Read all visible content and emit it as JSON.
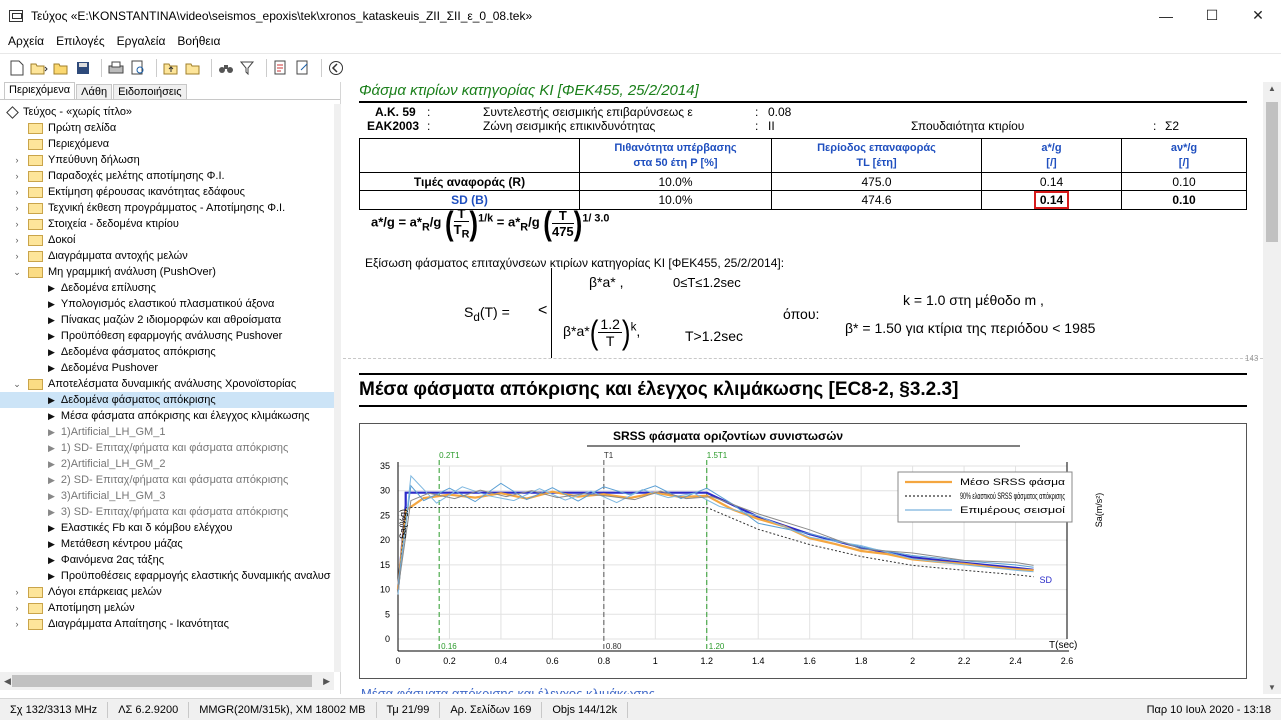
{
  "window": {
    "title": "Τεύχος «E:\\KONSTANTINA\\video\\seismos_epoxis\\tek\\xronos_kataskeuis_ZII_ΣII_ε_0_08.tek»",
    "minimize": "—",
    "maximize": "☐",
    "close": "✕"
  },
  "menu": [
    "Αρχεία",
    "Επιλογές",
    "Εργαλεία",
    "Βοήθεια"
  ],
  "tabs": [
    "Περιεχόμενα",
    "Λάθη",
    "Ειδοποιήσεις"
  ],
  "tree": [
    {
      "label": "Τεύχος - «χωρίς τίτλο»",
      "icon": "diamond",
      "level": 0,
      "exp": ""
    },
    {
      "label": "Πρώτη σελίδα",
      "icon": "folder",
      "level": 1,
      "exp": ""
    },
    {
      "label": "Περιεχόμενα",
      "icon": "folder",
      "level": 1,
      "exp": ""
    },
    {
      "label": "Υπεύθυνη δήλωση",
      "icon": "folder",
      "level": 1,
      "exp": ">"
    },
    {
      "label": "Παραδοχές μελέτης αποτίμησης Φ.Ι.",
      "icon": "folder",
      "level": 1,
      "exp": ">"
    },
    {
      "label": "Εκτίμηση φέρουσας ικανότητας εδάφους",
      "icon": "folder",
      "level": 1,
      "exp": ">"
    },
    {
      "label": "Τεχνική έκθεση προγράμματος - Αποτίμησης Φ.Ι.",
      "icon": "folder",
      "level": 1,
      "exp": ">"
    },
    {
      "label": "Στοιχεία - δεδομένα κτιρίου",
      "icon": "folder",
      "level": 1,
      "exp": ">"
    },
    {
      "label": "Δοκοί",
      "icon": "folder",
      "level": 1,
      "exp": ">"
    },
    {
      "label": "Διαγράμματα αντοχής μελών",
      "icon": "folder",
      "level": 1,
      "exp": ">"
    },
    {
      "label": "Μη γραμμική ανάλυση (PushOver)",
      "icon": "folder-open",
      "level": 1,
      "exp": "v"
    },
    {
      "label": "Δεδομένα επίλυσης",
      "icon": "arrow",
      "level": 2,
      "exp": ""
    },
    {
      "label": "Υπολογισμός ελαστικού πλασματικού άξονα",
      "icon": "arrow",
      "level": 2,
      "exp": ""
    },
    {
      "label": "Πίνακας μαζών 2 ιδιομορφών και αθροίσματα",
      "icon": "arrow",
      "level": 2,
      "exp": ""
    },
    {
      "label": "Προϋπόθεση εφαρμογής ανάλυσης Pushover",
      "icon": "arrow",
      "level": 2,
      "exp": ""
    },
    {
      "label": "Δεδομένα φάσματος απόκρισης",
      "icon": "arrow",
      "level": 2,
      "exp": ""
    },
    {
      "label": "Δεδομένα Pushover",
      "icon": "arrow",
      "level": 2,
      "exp": ""
    },
    {
      "label": "Αποτελέσματα δυναμικής ανάλυσης Χρονοϊστορίας",
      "icon": "folder-open",
      "level": 1,
      "exp": "v"
    },
    {
      "label": "Δεδομένα φάσματος απόκρισης",
      "icon": "arrow",
      "level": 2,
      "exp": "",
      "selected": true
    },
    {
      "label": "Μέσα φάσματα απόκρισης και έλεγχος κλιμάκωσης",
      "icon": "arrow",
      "level": 2,
      "exp": ""
    },
    {
      "label": "1)Artificial_LH_GM_1",
      "icon": "arrow-gray",
      "level": 2,
      "exp": ""
    },
    {
      "label": "1) SD- Επιταχ/φήματα και φάσματα απόκρισης",
      "icon": "arrow-gray",
      "level": 2,
      "exp": ""
    },
    {
      "label": "2)Artificial_LH_GM_2",
      "icon": "arrow-gray",
      "level": 2,
      "exp": ""
    },
    {
      "label": "2) SD- Επιταχ/φήματα και φάσματα απόκρισης",
      "icon": "arrow-gray",
      "level": 2,
      "exp": ""
    },
    {
      "label": "3)Artificial_LH_GM_3",
      "icon": "arrow-gray",
      "level": 2,
      "exp": ""
    },
    {
      "label": "3) SD- Επιταχ/φήματα και φάσματα απόκρισης",
      "icon": "arrow-gray",
      "level": 2,
      "exp": ""
    },
    {
      "label": "Ελαστικές Fb και δ κόμβου ελέγχου",
      "icon": "arrow",
      "level": 2,
      "exp": ""
    },
    {
      "label": "Μετάθεση κέντρου μάζας",
      "icon": "arrow",
      "level": 2,
      "exp": ""
    },
    {
      "label": "Φαινόμενα 2ας τάξης",
      "icon": "arrow",
      "level": 2,
      "exp": ""
    },
    {
      "label": "Προϋποθέσεις εφαρμογής ελαστικής δυναμικής αναλυσ",
      "icon": "arrow",
      "level": 2,
      "exp": ""
    },
    {
      "label": "Λόγοι επάρκειας μελών",
      "icon": "folder",
      "level": 1,
      "exp": ">"
    },
    {
      "label": "Αποτίμηση μελών",
      "icon": "folder",
      "level": 1,
      "exp": ">"
    },
    {
      "label": "Διαγράμματα Απαίτησης - Ικανότητας",
      "icon": "folder",
      "level": 1,
      "exp": ">"
    }
  ],
  "doc": {
    "heading1": "Φάσμα κτιρίων κατηγορίας ΚΙ [ΦΕΚ455, 25/2/2014]",
    "ak_label": "Α.Κ. 59",
    "ak_colon": ":",
    "ak_desc": "Συντελεστής σεισμικής επιβαρύνσεως ε",
    "ak_val": "0.08",
    "eak_label": "ΕΑΚ2003",
    "eak_colon": ":",
    "eak_desc": "Ζώνη σεισμικής επικινδυνότητας",
    "eak_val": "ΙΙ",
    "importance_label": "Σπουδαιότητα κτιρίου",
    "importance_colon": ":",
    "importance_val": "Σ2",
    "table": {
      "headers": [
        "",
        "Πιθανότητα υπέρβασης\nστα 50 έτη P [%]",
        "Περίοδος επαναφοράς\nTL [έτη]",
        "a*/g\n[/]",
        "aν*/g\n[/]"
      ],
      "rows": [
        [
          "Τιμές αναφοράς (R)",
          "10.0%",
          "475.0",
          "0.14",
          "0.10"
        ],
        [
          "SD (B)",
          "10.0%",
          "474.6",
          "0.14",
          "0.10"
        ]
      ]
    },
    "formula1": {
      "lhs": "a*/g  =  a*",
      "sub_r": "R",
      "mid": "/g",
      "t": "T",
      "tr": "T",
      "tr_sub": "R",
      "exp1": "1/k",
      "eq": "=  a*",
      "sub_r2": "R",
      "mid2": "/g",
      "t2": "T",
      "den2": "475",
      "exp2": "1/  3.0"
    },
    "eq_title": "Εξίσωση φάσματος επιταχύνσεων κτιρίων κατηγορίας ΚΙ [ΦΕΚ455, 25/2/2014]:",
    "sd_label": "S",
    "sd_sub": "d",
    "sd_rest": "(T)   =",
    "case1": "β*a* ,",
    "case1_cond": "0≤T≤1.2sec",
    "case2_pre": "β*a*",
    "case2_num": "1.2",
    "case2_den": "T",
    "case2_exp": "k",
    "case2_cond": "T>1.2sec",
    "opou": "όπου:",
    "k_line": "k = 1.0  στη μέθοδο m ,",
    "beta_line": "β* = 1.50  για κτίρια της περιόδου < 1985",
    "page_mark": "143",
    "heading2": "Μέσα φάσματα απόκρισης και έλεγχος κλιμάκωσης [EC8-2, §3.2.3]",
    "next_heading": "Μέσα φάσματα απόκρισης και έλεγχος κλιμάκωσης"
  },
  "chart_data": {
    "type": "line",
    "title": "SRSS φάσματα οριζοντίων συνιστωσών",
    "ylabel_left": "Sa(%g)",
    "ylabel_right": "Sa(m/s²)",
    "xlabel": "T(sec)",
    "xlim": [
      0,
      2.6
    ],
    "ylim": [
      0,
      35
    ],
    "xticks": [
      "0",
      "0.2",
      "0.4",
      "0.6",
      "0.8",
      "1",
      "1.2",
      "1.4",
      "1.6",
      "1.8",
      "2",
      "2.2",
      "2.4",
      "2.6"
    ],
    "yticks": [
      "0",
      "5",
      "10",
      "15",
      "20",
      "25",
      "30",
      "35"
    ],
    "markers_top": [
      {
        "x": 0.16,
        "label": "0.2T1"
      },
      {
        "x": 0.8,
        "label": "T1"
      },
      {
        "x": 1.2,
        "label": "1.5T1"
      }
    ],
    "markers_bottom": [
      {
        "x": 0.16,
        "label": "0.16"
      },
      {
        "x": 0.8,
        "label": "0.80"
      },
      {
        "x": 1.2,
        "label": "1.20"
      }
    ],
    "legend": [
      "Μέσο SRSS φάσμα",
      "90% ελαστικού SRSS φάσματος απόκρισης",
      "Επιμέρους σεισμοί"
    ],
    "legend_placement": "top-right",
    "sd_label": "SD",
    "series": [
      {
        "name": "SD",
        "color": "#2b2bc8",
        "x": [
          0,
          0.03,
          0.03,
          1.2,
          1.4,
          1.6,
          1.8,
          2.0,
          2.2,
          2.4,
          2.47
        ],
        "y": [
          10,
          27,
          29.6,
          29.6,
          24.7,
          21.2,
          18.5,
          16.5,
          15.4,
          14.4,
          14.0
        ]
      },
      {
        "name": "Μέσο SRSS φάσμα",
        "color": "#f4a640",
        "x": [
          0,
          0.03,
          0.1,
          0.2,
          0.3,
          0.4,
          0.5,
          0.6,
          0.7,
          0.8,
          0.9,
          1.0,
          1.1,
          1.2,
          1.3,
          1.4,
          1.5,
          1.6,
          1.7,
          1.8,
          1.9,
          2.0,
          2.1,
          2.2,
          2.3,
          2.4,
          2.47
        ],
        "y": [
          10,
          26,
          28.5,
          29.2,
          28.6,
          29.5,
          28.4,
          29.8,
          28.8,
          29.3,
          28.5,
          29.6,
          28.7,
          29.0,
          26.2,
          24.3,
          22.8,
          20.4,
          19.2,
          17.8,
          17.2,
          16.1,
          15.6,
          15.2,
          14.6,
          14.1,
          13.9
        ]
      },
      {
        "name": "90% ελαστικού SRSS",
        "color": "#333333",
        "dashed": true,
        "x": [
          0,
          0.03,
          1.2,
          1.4,
          1.6,
          1.8,
          2.0,
          2.2,
          2.4,
          2.47
        ],
        "y": [
          9,
          26.6,
          26.6,
          22.2,
          19.1,
          16.7,
          14.9,
          13.9,
          13.0,
          12.6
        ]
      },
      {
        "name": "Επιμέρους σεισμοί 1",
        "color": "#5a9fd4",
        "x": [
          0,
          0.05,
          0.1,
          0.2,
          0.3,
          0.4,
          0.5,
          0.6,
          0.7,
          0.8,
          0.9,
          1.0,
          1.1,
          1.2,
          1.3,
          1.4,
          1.6,
          1.8,
          2.0,
          2.2,
          2.4,
          2.47
        ],
        "y": [
          11,
          31,
          28,
          30.5,
          27.8,
          31.5,
          28.2,
          30.6,
          27.9,
          30.8,
          29.2,
          31.0,
          28.4,
          30.5,
          27.3,
          23.4,
          21.3,
          18.6,
          16.9,
          15.8,
          15.0,
          14.5
        ]
      },
      {
        "name": "Επιμέρους σεισμοί 2",
        "color": "#7fb8e0",
        "x": [
          0,
          0.05,
          0.15,
          0.25,
          0.35,
          0.45,
          0.55,
          0.65,
          0.75,
          0.85,
          0.95,
          1.05,
          1.15,
          1.25,
          1.4,
          1.6,
          1.8,
          2.0,
          2.2,
          2.4,
          2.47
        ],
        "y": [
          9,
          33,
          27.5,
          30.8,
          29.0,
          28.0,
          30.4,
          28.1,
          29.9,
          27.6,
          30.2,
          28.6,
          29.5,
          26.8,
          24.9,
          20.6,
          18.9,
          16.2,
          15.0,
          13.9,
          13.6
        ]
      },
      {
        "name": "Επιμέρους σεισμοί 3",
        "color": "#8a8a8a",
        "x": [
          0,
          0.05,
          0.12,
          0.22,
          0.32,
          0.42,
          0.52,
          0.62,
          0.72,
          0.82,
          0.92,
          1.02,
          1.12,
          1.22,
          1.4,
          1.6,
          1.8,
          2.0,
          2.2,
          2.4,
          2.47
        ],
        "y": [
          10,
          28,
          29.5,
          28.4,
          30.1,
          28.8,
          30.0,
          28.6,
          29.4,
          28.9,
          28.2,
          29.9,
          28.4,
          28.8,
          25.3,
          22.1,
          18.2,
          17.4,
          15.9,
          15.5,
          14.9
        ]
      }
    ]
  },
  "status": {
    "cpu": "Σχ 132/3313 MHz",
    "version": "ΛΣ 6.2.9200",
    "mem": "MMGR(20M/315k), XM 18002 MB",
    "page": "Τμ 21/99",
    "pages": "Αρ. Σελίδων 169",
    "objs": "Objs 144/12k",
    "time": "Παρ 10 Ιουλ 2020 - 13:18"
  }
}
